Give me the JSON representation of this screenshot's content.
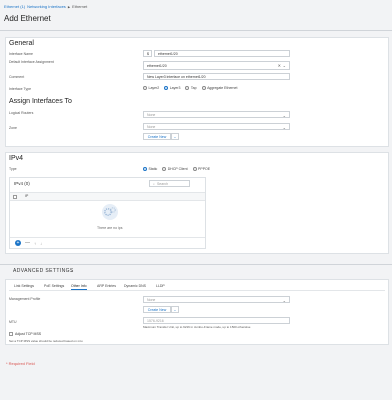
{
  "breadcrumb": {
    "link": "Ethernet (1)",
    "mid": "Networking Interfaces",
    "sep": "▶",
    "current": "Ethernet"
  },
  "title": "Add Ethernet",
  "general": {
    "title": "General",
    "interface_name": {
      "label": "Interface Name",
      "prefix": "$",
      "value": "ethernet1/20"
    },
    "default_assignment": {
      "label": "Default Interface Assignment",
      "value": "ethernet1/20"
    },
    "comment": {
      "label": "Comment",
      "value": "New Layer3 interface on ethernet1/20"
    },
    "interface_type": {
      "label": "Interface Type",
      "options": [
        "Layer2",
        "Layer3",
        "Tap",
        "Aggregate Ethernet"
      ],
      "selected": "Layer3"
    }
  },
  "assign": {
    "title": "Assign Interfaces To",
    "logical_router": {
      "label": "Logical Routers",
      "placeholder": "None"
    },
    "zone": {
      "label": "Zone",
      "placeholder": "None"
    },
    "create_new": "Create New"
  },
  "ipv4": {
    "title": "IPv4",
    "type_label": "Type",
    "options": [
      "Static",
      "DHCP Client",
      "PPPOE"
    ],
    "selected": "Static",
    "table": {
      "title": "IPv4 (0)",
      "search_placeholder": "Search",
      "col": "IP",
      "empty": "There are no ips"
    }
  },
  "advanced": {
    "title": "ADVANCED SETTINGS",
    "tabs": [
      "Link Settings",
      "PoE Settings",
      "Other Info",
      "ARP Entries",
      "Dynamic DNS",
      "LLDP"
    ],
    "active_tab": "Other Info",
    "mgmt_profile": {
      "label": "Management Profile",
      "placeholder": "None"
    },
    "create_new": "Create New",
    "mtu": {
      "label": "MTU",
      "placeholder": "1576-9216",
      "help": "Maximum Transfer Unit, up to 9216 in Jumbo-Frame mode, up to 1500 otherwise"
    },
    "adjust_tcp": {
      "label": "Adjust TCP MSS",
      "help": "Set a TCP MSS value should be reduced based on mtu"
    }
  },
  "required": "* Required Field"
}
